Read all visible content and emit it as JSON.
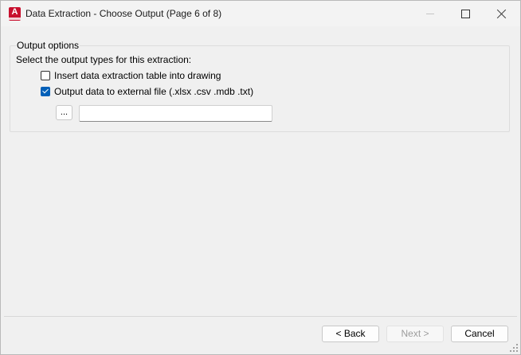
{
  "window": {
    "title": "Data Extraction - Choose Output (Page 6 of 8)",
    "app_icon_letter": "A"
  },
  "output_options": {
    "legend": "Output options",
    "instruction": "Select the output types for this extraction:",
    "options": [
      {
        "label": "Insert data extraction table into drawing",
        "checked": false
      },
      {
        "label": "Output data to external file (.xlsx .csv .mdb .txt)",
        "checked": true
      }
    ],
    "browse_label": "...",
    "file_path": ""
  },
  "footer": {
    "back_label": "< Back",
    "next_label": "Next >",
    "next_enabled": false,
    "cancel_label": "Cancel"
  },
  "colors": {
    "accent": "#005fb8",
    "app_icon": "#c8102e"
  }
}
